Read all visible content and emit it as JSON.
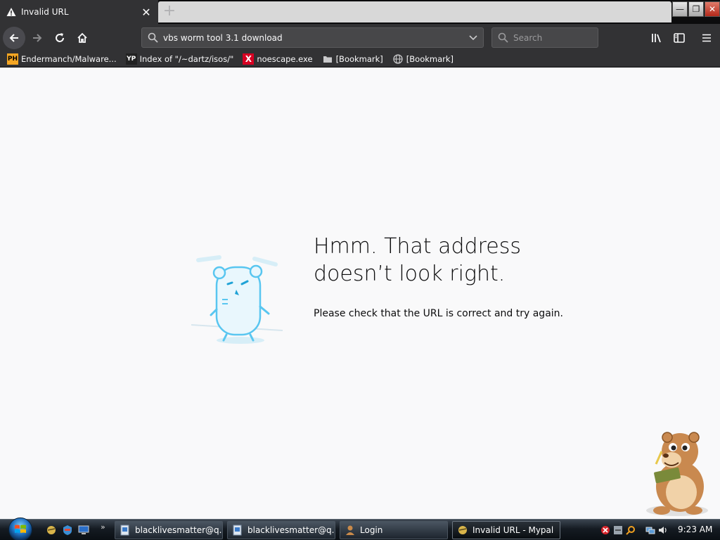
{
  "tab": {
    "title": "Invalid URL",
    "close_glyph": "✕",
    "new_tab_glyph": "+"
  },
  "window_controls": {
    "minimize": "—",
    "restore": "❐",
    "close": "✕"
  },
  "urlbar": {
    "value": "vbs worm tool 3.1 download"
  },
  "searchbar": {
    "placeholder": "Search"
  },
  "bookmarks": [
    {
      "label": "Endermanch/Malware...",
      "icon": "ph-icon"
    },
    {
      "label": "Index of \"/~dartz/isos/\"",
      "icon": "yp-icon"
    },
    {
      "label": "noescape.exe",
      "icon": "red-x-icon"
    },
    {
      "label": "[Bookmark]",
      "icon": "folder-icon"
    },
    {
      "label": "[Bookmark]",
      "icon": "globe-icon"
    }
  ],
  "error": {
    "title_line1": "Hmm. That address",
    "title_line2": "doesn’t look right.",
    "description": "Please check that the URL is correct and try again."
  },
  "taskbar": {
    "more_glyph": "»",
    "tasks": [
      {
        "label": "blacklivesmatter@q...",
        "active": false
      },
      {
        "label": "blacklivesmatter@q...",
        "active": false
      },
      {
        "label": "Login",
        "active": false
      },
      {
        "label": "Invalid URL - Mypal",
        "active": true
      }
    ],
    "clock": "9:23 AM"
  },
  "colors": {
    "chrome": "#323234",
    "titlebar": "#0c0c0d",
    "page_bg": "#f9f9fa",
    "illustration_blue": "#59c6f0"
  }
}
